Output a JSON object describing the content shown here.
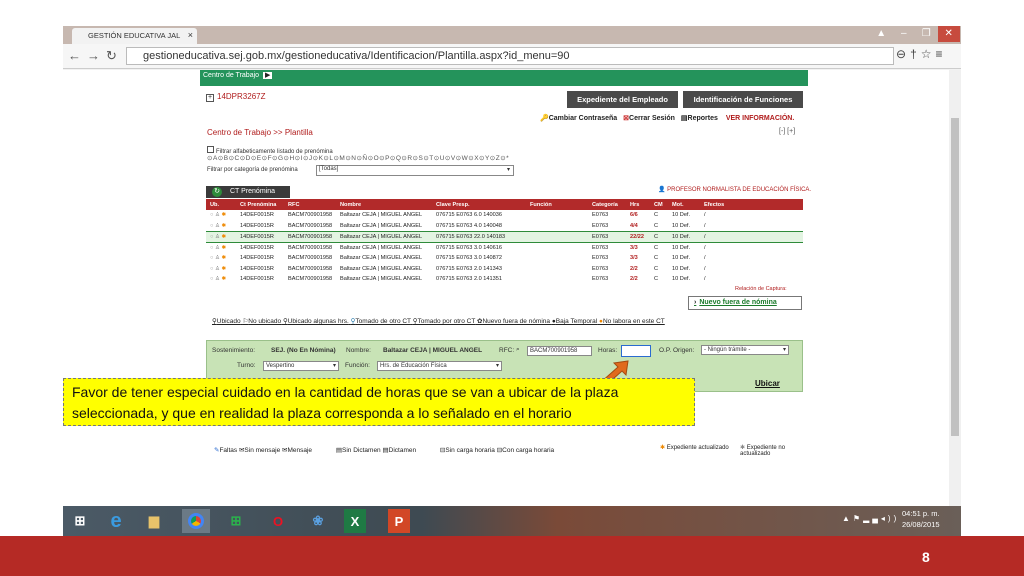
{
  "browser": {
    "tab_title": "GESTIÓN EDUCATIVA JAL",
    "tab_close": "×",
    "url": "gestioneducativa.sej.gob.mx/gestioneducativa/Identificacion/Plantilla.aspx?id_menu=90"
  },
  "page": {
    "top_breadcrumb": "Centro de Trabajo",
    "ct_id": "14DPR3267Z",
    "btn_expediente": "Expediente del Empleado",
    "btn_identificacion": "Identificación de Funciones",
    "link_cambiar": "Cambiar Contraseña",
    "link_cerrar": "Cerrar Sesión",
    "link_reportes": "Reportes",
    "link_ver_info": "VER INFORMACIÓN.",
    "subhead": "Centro de Trabajo >> Plantilla",
    "collapse_icons": "[-] [+]",
    "filter_alpha_label": "Filtrar alfabeticamente listado de prenómina",
    "alphabet": "⊙A⊙B⊙C⊙D⊙E⊙F⊙G⊙H⊙I⊙J⊙K⊙L⊙M⊙N⊙Ñ⊙O⊙P⊙Q⊙R⊙S⊙T⊙U⊙V⊙W⊙X⊙Y⊙Z⊙*",
    "filter_cat_label": "Filtrar por categoría de prenómina",
    "filter_cat_value": "[Todas]",
    "ct_tab": "CT Prenómina",
    "profesor_label": "PROFESOR NORMALISTA DE EDUCACIÓN FÍSICA.",
    "relacion_label": "Relación de Captura:",
    "nuevo_btn": "Nuevo fuera de nómina"
  },
  "table": {
    "headers": [
      "Ub.",
      "Ct Prenómina",
      "RFC",
      "Nombre",
      "Clave Presp.",
      "Función",
      "Categoría",
      "Hrs",
      "CM",
      "Mot.",
      "Efectos"
    ],
    "rows": [
      {
        "ct": "14DEF0015R",
        "rfc": "BACM700901958",
        "nombre": "Baltazar CEJA | MIGUEL ANGEL",
        "clave": "076715 E0763 6.0 140036",
        "cat": "E0763",
        "hrs": "6/6",
        "cm": "C",
        "mot": "10 Def.",
        "ef": "/"
      },
      {
        "ct": "14DEF0015R",
        "rfc": "BACM700901958",
        "nombre": "Baltazar CEJA | MIGUEL ANGEL",
        "clave": "076715 E0763 4.0 140048",
        "cat": "E0763",
        "hrs": "4/4",
        "cm": "C",
        "mot": "10 Def.",
        "ef": "/"
      },
      {
        "ct": "14DEF0015R",
        "rfc": "BACM700901958",
        "nombre": "Baltazar CEJA | MIGUEL ANGEL",
        "clave": "076715 E0763 22.0 140183",
        "cat": "E0763",
        "hrs": "22/22",
        "cm": "C",
        "mot": "10 Def.",
        "ef": "/"
      },
      {
        "ct": "14DEF0015R",
        "rfc": "BACM700901958",
        "nombre": "Baltazar CEJA | MIGUEL ANGEL",
        "clave": "076715 E0763 3.0 140616",
        "cat": "E0763",
        "hrs": "3/3",
        "cm": "C",
        "mot": "10 Def.",
        "ef": "/"
      },
      {
        "ct": "14DEF0015R",
        "rfc": "BACM700901958",
        "nombre": "Baltazar CEJA | MIGUEL ANGEL",
        "clave": "076715 E0763 3.0 140872",
        "cat": "E0763",
        "hrs": "3/3",
        "cm": "C",
        "mot": "10 Def.",
        "ef": "/"
      },
      {
        "ct": "14DEF0015R",
        "rfc": "BACM700901958",
        "nombre": "Baltazar CEJA | MIGUEL ANGEL",
        "clave": "076715 E0763 2.0 141343",
        "cat": "E0763",
        "hrs": "2/2",
        "cm": "C",
        "mot": "10 Def.",
        "ef": "/"
      },
      {
        "ct": "14DEF0015R",
        "rfc": "BACM700901958",
        "nombre": "Baltazar CEJA | MIGUEL ANGEL",
        "clave": "076715 E0763 2.0 141351",
        "cat": "E0763",
        "hrs": "2/2",
        "cm": "C",
        "mot": "10 Def.",
        "ef": "/"
      }
    ]
  },
  "legend": {
    "ubicado": "Ubicado",
    "no_ubicado": "No ubicado",
    "ubicado_algunas": "Ubicado algunas hrs.",
    "tomado_de_otro": "Tomado de otro CT",
    "tomado_por_otro": "Tomado por otro CT",
    "nuevo_fuera": "Nuevo fuera de nómina",
    "baja_temporal": "Baja Temporal",
    "no_labora": "No labora en este CT"
  },
  "form": {
    "sostenimiento_label": "Sostenimiento:",
    "sostenimiento_value": "SEJ. (No En Nómina)",
    "nombre_label": "Nombre:",
    "nombre_value": "Baltazar CEJA | MIGUEL ANGEL",
    "rfc_label": "RFC:",
    "rfc_value": "BACM700901958",
    "horas_label": "Horas:",
    "op_label": "O.P. Origen:",
    "op_value": "- Ningún trámite -",
    "turno_label": "Turno:",
    "turno_value": "Vespertino",
    "funcion_label": "Función:",
    "funcion_value": "Hrs. de Educación Física",
    "ubicar": "Ubicar"
  },
  "callout": {
    "line1": "Favor de tener especial cuidado en la cantidad de horas que se van a ubicar de la plaza",
    "line2": "seleccionada, y que en realidad la plaza corresponda a lo señalado en el horario"
  },
  "footer_legend": {
    "faltas": "Faltas",
    "sin_mensaje": "Sin mensaje",
    "mensaje": "Mensaje",
    "sin_dictamen": "Sin Dictamen",
    "dictamen": "Dictamen",
    "sin_carga": "Sin carga horaria",
    "con_carga": "Con carga horaria",
    "exp_actualizado": "Expediente actualizado",
    "exp_no_actualizado": "Expediente no actualizado"
  },
  "taskbar": {
    "time": "04:51 p. m.",
    "date": "26/08/2015"
  },
  "slide": {
    "page_number": "8"
  },
  "colors": {
    "header_green": "#24935b",
    "table_header_red": "#b22a2a",
    "callout_yellow": "#ffff00",
    "slide_footer_red": "#b52a25"
  }
}
